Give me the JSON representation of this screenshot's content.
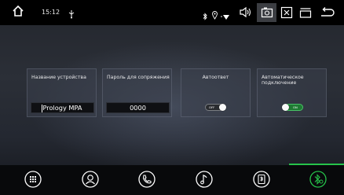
{
  "status_bar": {
    "time": "15:12",
    "icons": [
      "home-icon",
      "usb-icon",
      "bluetooth-icon",
      "location-icon",
      "wifi-icon",
      "volume-icon",
      "screenshot-icon",
      "close-box-icon",
      "window-icon",
      "back-icon"
    ]
  },
  "cards": [
    {
      "label": "Название устройства",
      "value": "Prology MPA"
    },
    {
      "label": "Пароль для сопряжения",
      "value": "0000"
    },
    {
      "label": "Автоответ",
      "toggle_text": "OFF",
      "toggle_on": false
    },
    {
      "label": "Автоматическое подключение",
      "toggle_text": "ON",
      "toggle_on": true
    }
  ],
  "dock": {
    "items": [
      "apps-icon",
      "contacts-icon",
      "phone-icon",
      "music-icon",
      "bluetooth-file-icon",
      "bluetooth-settings-icon"
    ],
    "active": "bluetooth-settings-icon",
    "accent_color": "#26c24a"
  }
}
